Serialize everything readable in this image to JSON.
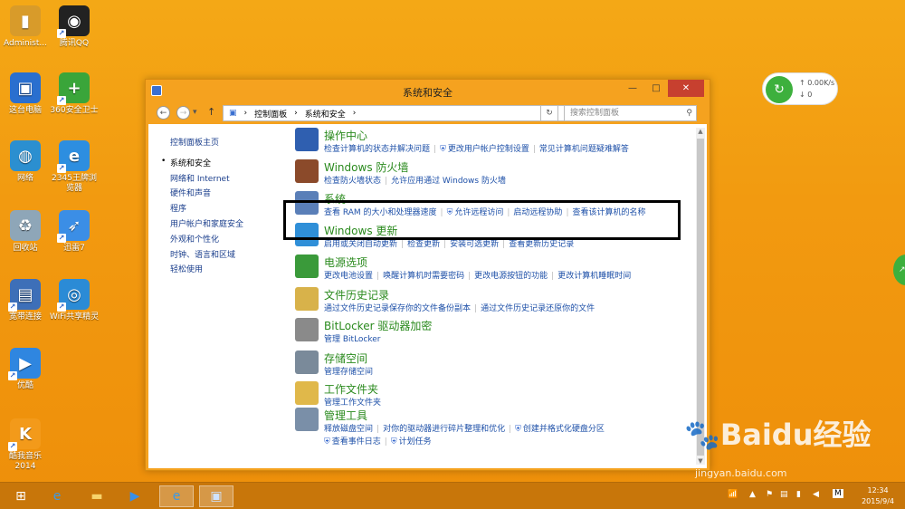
{
  "desktop_icons": [
    {
      "label": "Administ...",
      "icon": "user-folder-icon",
      "color": "#d89b2a"
    },
    {
      "label": "腾讯QQ",
      "icon": "qq-penguin-icon",
      "color": "#222222"
    },
    {
      "label": "这台电脑",
      "icon": "computer-icon",
      "color": "#2a6fcf"
    },
    {
      "label": "360安全卫士",
      "icon": "360-safe-icon",
      "color": "#3aa53a"
    },
    {
      "label": "网络",
      "icon": "network-globe-icon",
      "color": "#2b8fd0"
    },
    {
      "label": "2345王牌浏览器",
      "icon": "browser-e-icon",
      "color": "#2d8ee0"
    },
    {
      "label": "回收站",
      "icon": "recycle-bin-icon",
      "color": "#8ea6b8"
    },
    {
      "label": "迅雷7",
      "icon": "thunder-bird-icon",
      "color": "#3b8ee6"
    },
    {
      "label": "宽带连接",
      "icon": "broadband-icon",
      "color": "#3d6fb8"
    },
    {
      "label": "WiFi共享精灵",
      "icon": "wifi-share-icon",
      "color": "#2b8bd6"
    },
    {
      "label": "优酷",
      "icon": "youku-play-icon",
      "color": "#2f86e0"
    },
    {
      "label": "酷我音乐2014",
      "icon": "kuwo-music-icon",
      "color": "#f39a1a"
    }
  ],
  "window": {
    "title": "系统和安全",
    "minimize": "—",
    "maximize": "□",
    "close": "✕",
    "breadcrumb": [
      "控制面板",
      "系统和安全"
    ],
    "search_placeholder": "搜索控制面板"
  },
  "leftnav": {
    "home": "控制面板主页",
    "items": [
      "系统和安全",
      "网络和 Internet",
      "硬件和声音",
      "程序",
      "用户帐户和家庭安全",
      "外观和个性化",
      "时钟、语言和区域",
      "轻松使用"
    ]
  },
  "categories": [
    {
      "title": "操作中心",
      "icon": "action-center-flag-icon",
      "links": [
        "检查计算机的状态并解决问题",
        "更改用户帐户控制设置",
        "常见计算机问题疑难解答"
      ],
      "shield": [
        false,
        true,
        false
      ]
    },
    {
      "title": "Windows 防火墙",
      "icon": "firewall-icon",
      "links": [
        "检查防火墙状态",
        "允许应用通过 Windows 防火墙"
      ],
      "shield": [
        false,
        false
      ]
    },
    {
      "title": "系统",
      "icon": "system-computer-icon",
      "links": [
        "查看 RAM 的大小和处理器速度",
        "允许远程访问",
        "启动远程协助",
        "查看该计算机的名称"
      ],
      "shield": [
        false,
        true,
        false,
        false
      ]
    },
    {
      "title": "Windows 更新",
      "icon": "windows-update-icon",
      "links": [
        "启用或关闭自动更新",
        "检查更新",
        "安装可选更新",
        "查看更新历史记录"
      ],
      "shield": [
        false,
        false,
        false,
        false
      ]
    },
    {
      "title": "电源选项",
      "icon": "power-options-icon",
      "links": [
        "更改电池设置",
        "唤醒计算机时需要密码",
        "更改电源按钮的功能",
        "更改计算机睡眠时间"
      ],
      "shield": [
        false,
        false,
        false,
        false
      ]
    },
    {
      "title": "文件历史记录",
      "icon": "file-history-icon",
      "links": [
        "通过文件历史记录保存你的文件备份副本",
        "通过文件历史记录还原你的文件"
      ],
      "shield": [
        false,
        false
      ]
    },
    {
      "title": "BitLocker 驱动器加密",
      "icon": "bitlocker-icon",
      "links": [
        "管理 BitLocker"
      ],
      "shield": [
        false
      ]
    },
    {
      "title": "存储空间",
      "icon": "storage-spaces-icon",
      "links": [
        "管理存储空间"
      ],
      "shield": [
        false
      ]
    },
    {
      "title": "工作文件夹",
      "icon": "work-folders-icon",
      "links": [
        "管理工作文件夹"
      ],
      "shield": [
        false
      ]
    },
    {
      "title": "管理工具",
      "icon": "admin-tools-icon",
      "links": [
        "释放磁盘空间",
        "对你的驱动器进行碎片整理和优化",
        "创建并格式化硬盘分区"
      ],
      "links2": [
        "查看事件日志",
        "计划任务"
      ],
      "shield": [
        false,
        false,
        true
      ],
      "shield2": [
        true,
        true
      ]
    }
  ],
  "net_widget": {
    "speed": "0.00K/s",
    "count": "0"
  },
  "taskbar": {
    "clock_time": "12:34",
    "clock_date": "2015/9/4",
    "ime": "M"
  },
  "watermark": {
    "logo": "Baidu经验",
    "url": "jingyan.baidu.com"
  }
}
